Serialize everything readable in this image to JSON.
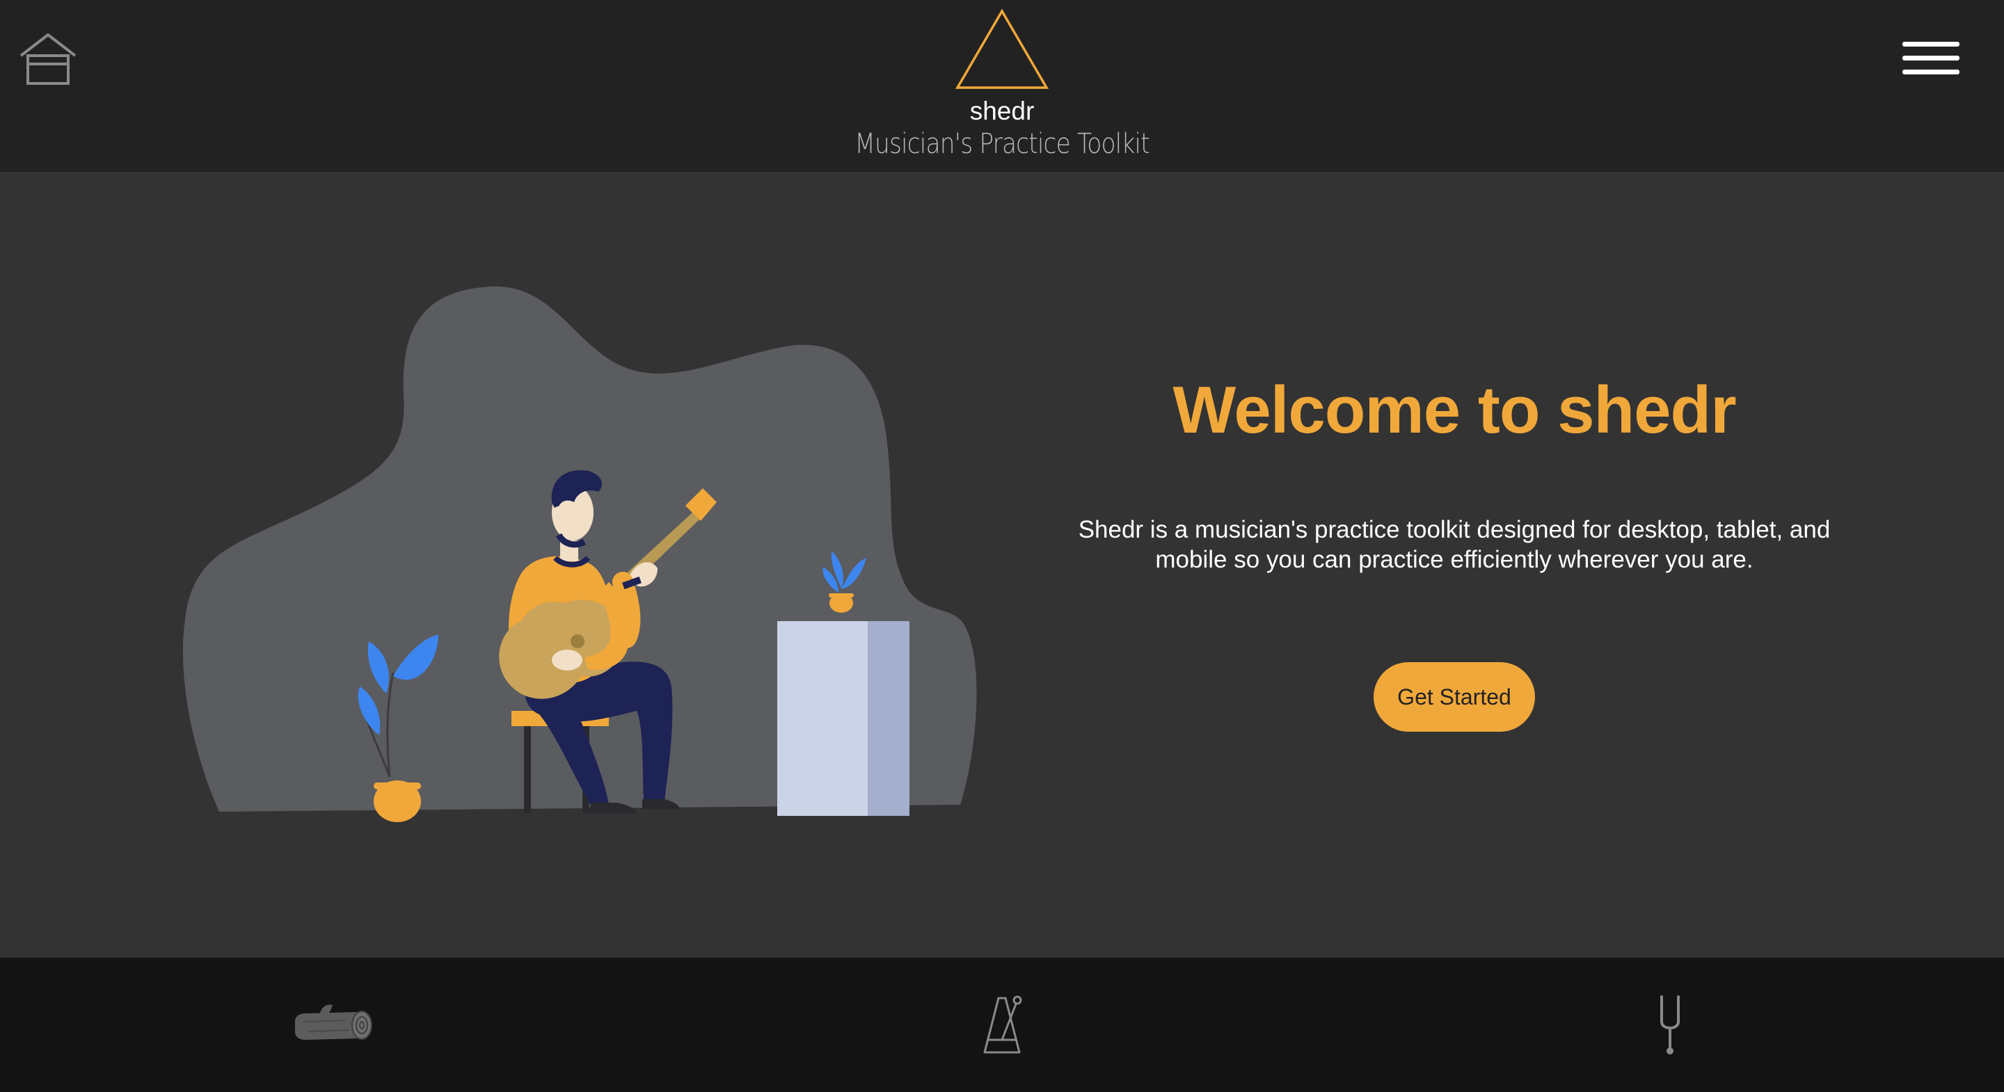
{
  "header": {
    "home_icon": "home-icon",
    "menu_icon": "hamburger-menu-icon",
    "brand": {
      "logo_icon": "triangle-logo-icon",
      "name": "shedr",
      "tagline": "Musician's Practice Toolkit"
    }
  },
  "hero": {
    "illustration": "guitarist-illustration",
    "title": "Welcome to shedr",
    "description": "Shedr is a musician's practice toolkit designed for desktop, tablet, and mobile so you can practice efficiently wherever you are.",
    "cta_label": "Get Started"
  },
  "bottom_nav": {
    "items": [
      {
        "icon": "log-icon"
      },
      {
        "icon": "metronome-icon"
      },
      {
        "icon": "tuning-fork-icon"
      }
    ]
  },
  "colors": {
    "accent": "#f1a83a",
    "header_bg": "#222222",
    "main_bg": "#333333",
    "nav_bg": "#131313",
    "blob": "#5a5c60"
  }
}
